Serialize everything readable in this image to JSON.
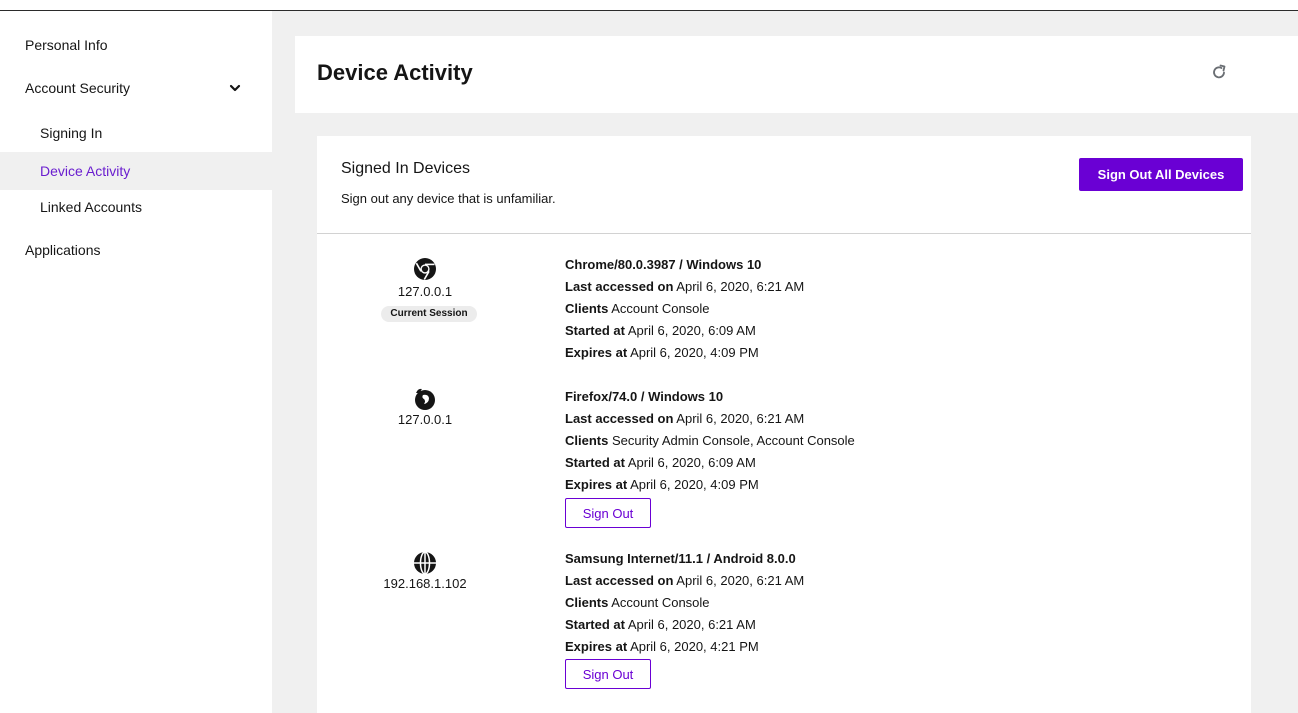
{
  "sidebar": {
    "items": [
      {
        "label": "Personal Info"
      },
      {
        "label": "Account Security"
      },
      {
        "label": "Signing In"
      },
      {
        "label": "Device Activity"
      },
      {
        "label": "Linked Accounts"
      },
      {
        "label": "Applications"
      }
    ]
  },
  "header": {
    "title": "Device Activity",
    "refresh_icon": "refresh-icon"
  },
  "card": {
    "title": "Signed In Devices",
    "subtitle": "Sign out any device that is unfamiliar.",
    "sign_out_all_label": "Sign Out All Devices"
  },
  "labels": {
    "last_accessed": "Last accessed on",
    "clients": "Clients",
    "started": "Started at",
    "expires": "Expires at",
    "sign_out": "Sign Out",
    "current_session": "Current Session"
  },
  "devices": [
    {
      "icon": "chrome-icon",
      "ip": "127.0.0.1",
      "name": "Chrome/80.0.3987 / Windows 10",
      "last_accessed": "April 6, 2020, 6:21 AM",
      "clients": "Account Console",
      "started": "April 6, 2020, 6:09 AM",
      "expires": "April 6, 2020, 4:09 PM",
      "current": true
    },
    {
      "icon": "firefox-icon",
      "ip": "127.0.0.1",
      "name": "Firefox/74.0 / Windows 10",
      "last_accessed": "April 6, 2020, 6:21 AM",
      "clients": "Security Admin Console, Account Console",
      "started": "April 6, 2020, 6:09 AM",
      "expires": "April 6, 2020, 4:09 PM",
      "current": false
    },
    {
      "icon": "globe-icon",
      "ip": "192.168.1.102",
      "name": "Samsung Internet/11.1 / Android 8.0.0",
      "last_accessed": "April 6, 2020, 6:21 AM",
      "clients": "Account Console",
      "started": "April 6, 2020, 6:21 AM",
      "expires": "April 6, 2020, 4:21 PM",
      "current": false
    }
  ],
  "colors": {
    "accent": "#6a00d4",
    "active_nav_text": "#6a1ecf",
    "page_bg": "#f0f0f0"
  }
}
